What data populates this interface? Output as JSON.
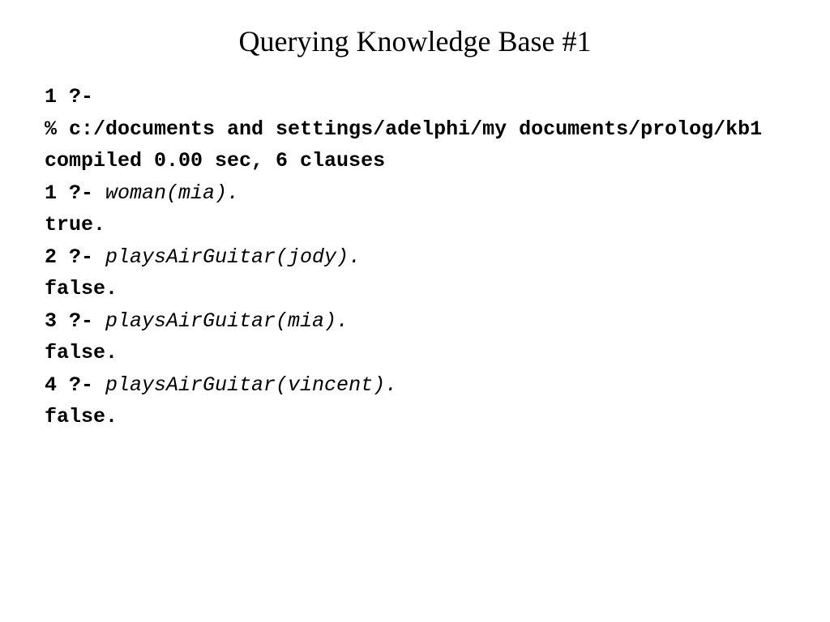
{
  "title": "Querying Knowledge Base #1",
  "lines": {
    "l0": "1 ?-",
    "l1": "% c:/documents and settings/adelphi/my documents/prolog/kb1 compiled 0.00 sec, 6 clauses",
    "q1_prompt": "1 ?- ",
    "q1_query": "woman(mia).",
    "r1": "true.",
    "q2_prompt": "2 ?- ",
    "q2_query": "playsAirGuitar(jody).",
    "r2": "false.",
    "q3_prompt": "3 ?- ",
    "q3_query": "playsAirGuitar(mia).",
    "r3": "false.",
    "q4_prompt": "4 ?- ",
    "q4_query": "playsAirGuitar(vincent).",
    "r4": "false."
  }
}
